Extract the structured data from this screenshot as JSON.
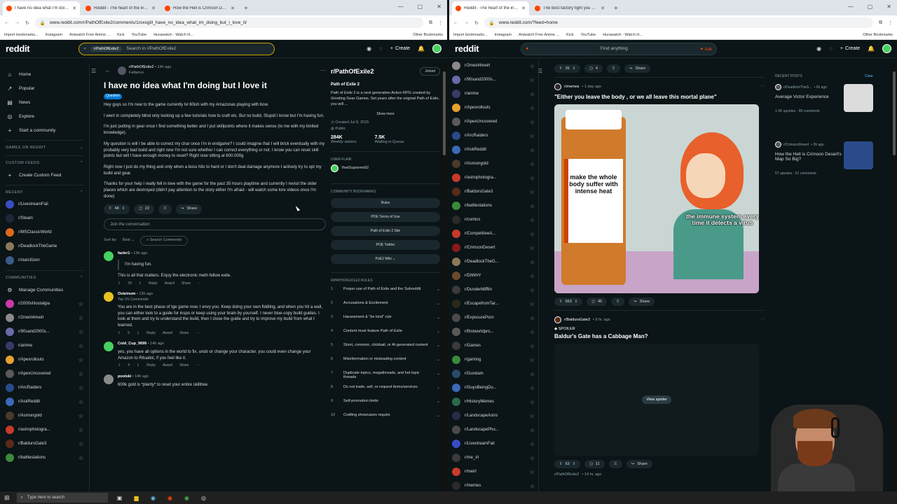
{
  "left": {
    "tabs": [
      {
        "title": "I have no idea what I'm doing b",
        "active": true
      },
      {
        "title": "Reddit - The heart of the intern",
        "active": false
      },
      {
        "title": "How the Hell is Crimson Desert",
        "active": false
      }
    ],
    "url": "www.reddit.com/r/PathOfExile2/comments/1roxxgl/i_have_no_idea_what_im_doing_but_i_love_it/",
    "bookmarks": [
      "Import bookmarks...",
      "Instagram",
      "Aniwatch Free Anime ...",
      "Kick",
      "YouTube",
      "Hurawatch - Watch H..."
    ],
    "other_bookmarks": "Other Bookmarks",
    "search_chip": "r/PathOfExile2",
    "search_placeholder": "Search in r/PathOfExile2",
    "create": "Create",
    "nav": [
      {
        "icon": "home-icon",
        "glyph": "⌂",
        "label": "Home"
      },
      {
        "icon": "popular-icon",
        "glyph": "↗",
        "label": "Popular"
      },
      {
        "icon": "news-icon",
        "glyph": "▤",
        "label": "News"
      },
      {
        "icon": "explore-icon",
        "glyph": "◎",
        "label": "Explore"
      },
      {
        "icon": "plus-icon",
        "glyph": "+",
        "label": "Start a community"
      }
    ],
    "sections": {
      "games": "GAMES ON REDDIT",
      "feeds": "CUSTOM FEEDS",
      "create_feed": "Create Custom Feed",
      "recent": "RECENT",
      "communities": "COMMUNITIES",
      "manage": "Manage Communities"
    },
    "recent": [
      {
        "name": "r/LivestreamFail",
        "color": "#3a4cc4"
      },
      {
        "name": "r/Steam",
        "color": "#1b2838"
      },
      {
        "name": "r/MSClassicWorld",
        "color": "#d96a1a"
      },
      {
        "name": "r/DeadlockTheGame",
        "color": "#8a7a5a"
      },
      {
        "name": "r/starcitizen",
        "color": "#3a5a8a"
      }
    ],
    "communities": [
      {
        "name": "r/2000sNostalgia",
        "color": "#c83aa8"
      },
      {
        "name": "r/2meirl4meirl",
        "color": "#8a8a8a"
      },
      {
        "name": "r/90sand2000s...",
        "color": "#6a6aa8"
      },
      {
        "name": "r/anime",
        "color": "#3a3a6a"
      },
      {
        "name": "r/Apexrollouts",
        "color": "#e8a030"
      },
      {
        "name": "r/ApexUncovered",
        "color": "#5a5a5a"
      },
      {
        "name": "r/ArcRaiders",
        "color": "#2a4a8a"
      },
      {
        "name": "r/AskReddit",
        "color": "#3a6ab8"
      },
      {
        "name": "r/Asmongold",
        "color": "#4a3a2a"
      },
      {
        "name": "r/astrophotogra...",
        "color": "#c83a2a"
      },
      {
        "name": "r/BaldursGate3",
        "color": "#5a2a1a"
      },
      {
        "name": "r/battlestations",
        "color": "#3a8a3a"
      }
    ],
    "post": {
      "sub": "r/PathOfExile2",
      "age": "• 14h ago",
      "author": "Fatlance",
      "title": "I have no idea what I'm doing but I love it",
      "flair": "Question",
      "paragraphs": [
        "Hey guys so I'm new to the game currently lvl 60ish with my Amazonas playing with bow.",
        "I went in completely blind only looking up a few tutorials how to craft etc. But no build. Stupid I know but I'm having fun.",
        "I'm just putting in gear once I find something better and I put skillpoints where it makes sense (to me with my limited knowledge).",
        "My question is will I be able to correct my char once I'm in endgame? I could imagine that I will brick eventually with my probably very bad build and right now I'm not sure whether I can correct everything or not. I know you can reset skill points but will I have enough money to reset? Right now sitting at 600.000g",
        "Right now I just do my thing and only when a boss hits to hard or I don't deal damage anymore I actively try to opt my build and gear.",
        "Thanks for your help I really fell in love with the game for the past 35 hours playtime and currently I revisit the older places which are destroyed (didn't pay attention to the story either I'm afraid - will watch some lore videos once I'm done)"
      ],
      "votes": "48",
      "comments": "22",
      "share": "Share",
      "join_placeholder": "Join the conversation",
      "sort_label": "Sort by:",
      "sort_value": "Best",
      "search_comments": "Search Comments"
    },
    "comments": [
      {
        "user": "fazler1",
        "age": "• 13h ago",
        "color": "#46d160",
        "quote": "I'm having fun.",
        "text": "This is all that matters. Enjoy the electronic meth fellow exile.",
        "votes": "29",
        "flair": ""
      },
      {
        "user": "Osteinum",
        "age": "• 13h ago",
        "color": "#e8c020",
        "quote": "",
        "flair": "Top 1% Commenter",
        "text": "You are in the best phase of tge game now, I envy you. Keep doing your own fiddling, and when you hit a wall, you can either look to a guide for inspo or keep using your brain by yourself. I never blue-copy build guides. I look at them and try to understand the build, then I close the guide and try to improve my build from what I learned.",
        "votes": "5"
      },
      {
        "user": "Cold_Cup_9696",
        "age": "• 14h ago",
        "color": "#46d160",
        "quote": "",
        "flair": "",
        "text": "yes, you have all options in the world to fix, undo or change your character. you could even change your Amazon to Ritualist, if you feel like it.",
        "votes": "4"
      },
      {
        "user": "poolski",
        "age": "• 14h ago",
        "color": "#8a8a8a",
        "quote": "",
        "flair": "",
        "text": "600k gold is *plenty* to reset your entire skilltree.",
        "votes": ""
      }
    ],
    "comment_actions": {
      "reply": "Reply",
      "award": "Award",
      "share": "Share"
    },
    "about": {
      "name": "r/PathOfExile2",
      "joined": "Joined",
      "title": "Path of Exile 2",
      "desc": "Path of Exile 2 is a next generation Action RPG created by Grinding Gear Games. Set years after the original Path of Exile, you will ...",
      "show_more": "Show more",
      "created": "Created Jul 8, 2015",
      "public": "Public",
      "visitors": "284K",
      "visitors_label": "Weekly visitors",
      "queue": "7.5K",
      "queue_label": "Waiting in Queue",
      "user_flair": "USER FLAIR",
      "flair_user": "YeetSupreme92",
      "bookmarks_label": "COMMUNITY BOOKMARKS",
      "bookmarks": [
        "Rules",
        "POE Terms of Use",
        "Path of Exile 2 Site",
        "POE Twitter",
        "PoE2 Wiki ⌄"
      ],
      "rules_label": "R/PATHOFEXILE2 RULES",
      "rules": [
        "Proper use of Path of Exile and the Subreddit",
        "Accusations & Excitement",
        "Harassment & \"be kind\" rule",
        "Content must feature Path of Exile",
        "Short, common, clickbait, or AI-generated content",
        "Misinformation or misleading content",
        "Duplicate topics, megathreads, and hot topic threads",
        "Do not trade, sell, or request items/services",
        "Self-promotion limits",
        "Crafting showcases require"
      ]
    }
  },
  "right": {
    "tabs": [
      {
        "title": "Reddit - The heart of the intern",
        "active": true
      },
      {
        "title": "The best factory fight you will s",
        "active": false
      }
    ],
    "url": "www.reddit.com/?feed=home",
    "bookmarks": [
      "Import bookmarks...",
      "Instagram",
      "Aniwatch Free Anime ...",
      "Kick",
      "YouTube",
      "Hurawatch - Watch H..."
    ],
    "other_bookmarks": "Other Bookmarks",
    "search_placeholder": "Find anything",
    "ask": "Ask",
    "create": "Create",
    "communities": [
      {
        "name": "r/2meirl4meirl",
        "color": "#8a8a8a"
      },
      {
        "name": "r/90sand2000s...",
        "color": "#6a6aa8"
      },
      {
        "name": "r/anime",
        "color": "#3a3a6a"
      },
      {
        "name": "r/Apexrollouts",
        "color": "#e8a030"
      },
      {
        "name": "r/ApexUncovered",
        "color": "#5a5a5a"
      },
      {
        "name": "r/ArcRaiders",
        "color": "#2a4a8a"
      },
      {
        "name": "r/AskReddit",
        "color": "#3a6ab8"
      },
      {
        "name": "r/Asmongold",
        "color": "#4a3a2a"
      },
      {
        "name": "r/astrophotogra...",
        "color": "#c83a2a"
      },
      {
        "name": "r/BaldursGate3",
        "color": "#5a2a1a"
      },
      {
        "name": "r/battlestations",
        "color": "#3a8a3a"
      },
      {
        "name": "r/comics",
        "color": "#2a2a2a"
      },
      {
        "name": "r/CompetitiveA...",
        "color": "#c83a2a"
      },
      {
        "name": "r/CrimsonDesert",
        "color": "#8a1a1a"
      },
      {
        "name": "r/DeadlockTheG...",
        "color": "#8a7a5a"
      },
      {
        "name": "r/DIWHY",
        "color": "#6a4a2a"
      },
      {
        "name": "r/DunderMifflin",
        "color": "#3a3a3a"
      },
      {
        "name": "r/EscapefromTar...",
        "color": "#2a2a1a"
      },
      {
        "name": "r/ExposurePorn",
        "color": "#4a4a4a"
      },
      {
        "name": "r/firstworldpro...",
        "color": "#5a5a5a"
      },
      {
        "name": "r/Games",
        "color": "#3a3a3a"
      },
      {
        "name": "r/gaming",
        "color": "#3a8a3a"
      },
      {
        "name": "r/Gundam",
        "color": "#2a4a6a"
      },
      {
        "name": "r/GuysBeingDu...",
        "color": "#3a6ab8"
      },
      {
        "name": "r/HistoryMemes",
        "color": "#2a6a4a"
      },
      {
        "name": "r/LandscapeAstro",
        "color": "#2a2a4a"
      },
      {
        "name": "r/LandscapePho...",
        "color": "#4a4a4a"
      },
      {
        "name": "r/LivestreamFail",
        "color": "#3a4cc4"
      },
      {
        "name": "r/me_irl",
        "color": "#3a3a3a"
      },
      {
        "name": "r/meirl",
        "color": "#c83a2a"
      },
      {
        "name": "r/memes",
        "color": "#2a2a2a"
      }
    ],
    "feed": [
      {
        "sub": "r/memes",
        "age": "• 1 day ago",
        "title": "\"Either you leave the body , or we all leave this mortal plane\"",
        "votes": "663",
        "comments": "45",
        "share": "Share",
        "meme_bottle": "make the whole body suffer with intense heat",
        "meme_caption": "the immune system every time it detects a virus"
      },
      {
        "sub": "r/BaldursGate3",
        "age": "• 9 hr. ago",
        "spoiler": "SPOILER",
        "title": "Baldur's Gate has a Cabbage Man?",
        "view_spoiler": "View spoiler",
        "votes": "63",
        "comments": "11",
        "share": "Share"
      }
    ],
    "top_bar": {
      "votes": "26",
      "comments": "4",
      "share": "Share"
    },
    "next_post_sub": "r/PathOfExile2",
    "next_post_age": "• 14 hr. ago",
    "recent_posts": {
      "label": "RECENT POSTS",
      "clear": "Clear",
      "items": [
        {
          "sub": "r/DeadlockTheG...",
          "age": "• 6h ago",
          "title": "Average Victor Experience",
          "meta": "1.5K upvotes · 68 comments",
          "thumb": "#dcdcdc"
        },
        {
          "sub": "r/CrimsonDesert",
          "age": "• 3h ago",
          "title": "How the Hell is Crimson Desert's Map So Big?",
          "meta": "57 upvotes · 61 comments",
          "thumb": "#2a4a8a"
        }
      ]
    }
  },
  "taskbar": {
    "search": "Type here to search"
  }
}
